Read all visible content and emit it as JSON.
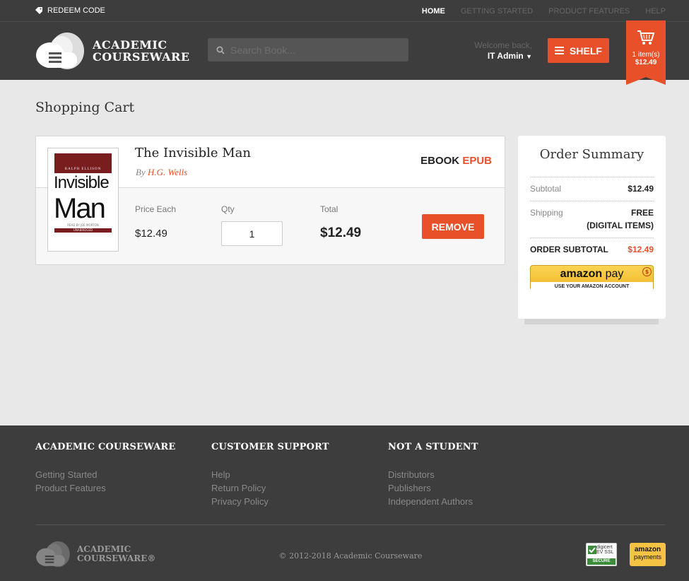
{
  "topbar": {
    "redeem_label": "REDEEM CODE",
    "nav": [
      "HOME",
      "GETTING STARTED",
      "PRODUCT FEATURES",
      "HELP"
    ]
  },
  "header": {
    "logo_line1": "ACADEMIC",
    "logo_line2": "COURSEWARE",
    "search_placeholder": "Search Book...",
    "welcome_label": "Welcome back,",
    "user_name": "IT Admin",
    "shelf_label": "SHELF",
    "cart_items": "1 item(s)",
    "cart_total": "$12.49"
  },
  "page": {
    "title": "Shopping Cart"
  },
  "cart": {
    "item": {
      "title": "The Invisible Man",
      "author_prefix": "By",
      "author": "H.G. Wells",
      "format_type": "EBOOK",
      "format_name": "EPUB",
      "cover_author": "RALPH ELLISON",
      "cover_word1": "Invisible",
      "cover_word2": "Man",
      "cover_narrator": "READ BY JOE MORTON",
      "cover_unabridged": "UNABRIDGED",
      "price_label": "Price Each",
      "price": "$12.49",
      "qty_label": "Qty",
      "qty": "1",
      "total_label": "Total",
      "total": "$12.49",
      "remove_label": "REMOVE"
    }
  },
  "summary": {
    "title": "Order Summary",
    "subtotal_label": "Subtotal",
    "subtotal": "$12.49",
    "shipping_label": "Shipping",
    "shipping_value": "FREE",
    "shipping_note": "(DIGITAL ITEMS)",
    "order_subtotal_label": "ORDER SUBTOTAL",
    "order_subtotal": "$12.49",
    "amazon_word1": "amazon",
    "amazon_word2": "pay",
    "amazon_sub": "USE YOUR AMAZON ACCOUNT",
    "amazon_coin": "$"
  },
  "footer": {
    "col1_title": "ACADEMIC COURSEWARE",
    "col1_links": [
      "Getting Started",
      "Product Features"
    ],
    "col2_title": "CUSTOMER SUPPORT",
    "col2_links": [
      "Help",
      "Return Policy",
      "Privacy Policy"
    ],
    "col3_title": "NOT A STUDENT",
    "col3_links": [
      "Distributors",
      "Publishers",
      "Independent Authors"
    ],
    "logo_line1": "ACADEMIC",
    "logo_line2": "COURSEWARE®",
    "copyright": "© 2012-2018 Academic Courseware",
    "digicert_line1": "digicert",
    "digicert_line2": "EV SSL",
    "digicert_secure": "SECURE",
    "amazon_payments1": "amazon",
    "amazon_payments2": "payments"
  },
  "colors": {
    "accent": "#e8502a",
    "header_bg": "#3d3d3d",
    "page_bg": "#e8e8e8"
  },
  "icons": [
    "tag-icon",
    "search-icon",
    "caret-down-icon",
    "menu-icon",
    "cart-icon",
    "cloud-logo-icon"
  ]
}
